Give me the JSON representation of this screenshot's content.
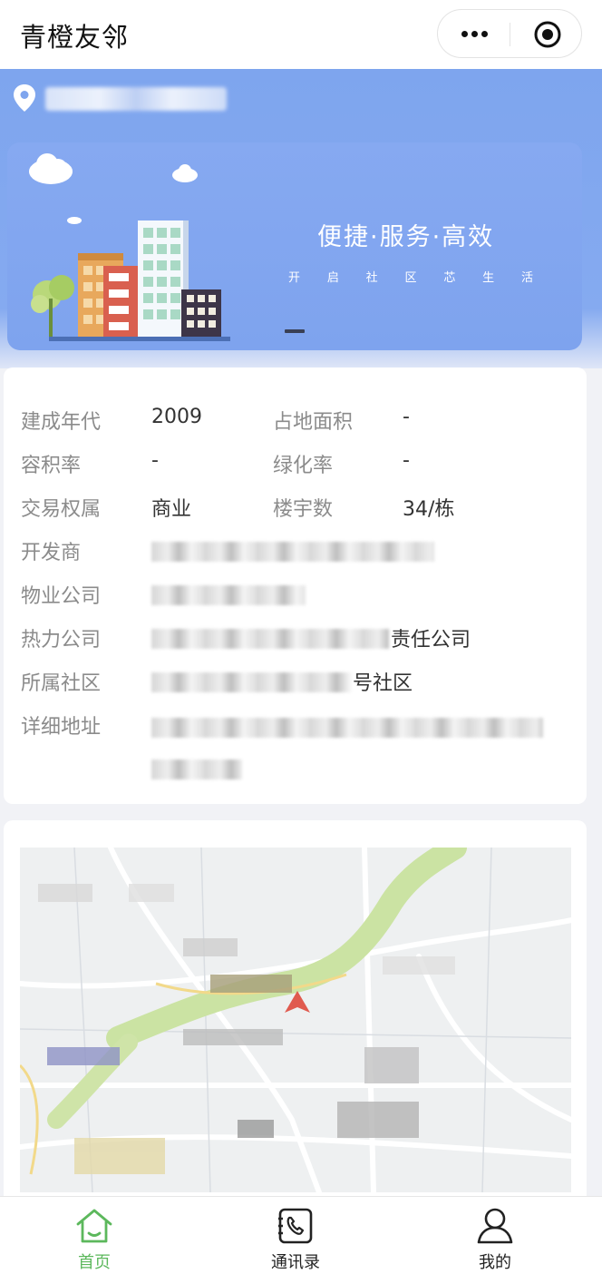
{
  "app": {
    "title": "青橙友邻"
  },
  "capsule": {
    "more_icon": "more-dots-icon",
    "close_icon": "target-icon"
  },
  "location": {
    "icon": "location-pin-icon"
  },
  "banner": {
    "slogan": "便捷·服务·高效",
    "sub_slogan": [
      "开",
      "启",
      "社",
      "区",
      "芯",
      "生",
      "活"
    ]
  },
  "info": {
    "rows": [
      {
        "label": "建成年代",
        "value": "2009",
        "label2": "占地面积",
        "value2": "-"
      },
      {
        "label": "容积率",
        "value": "-",
        "label2": "绿化率",
        "value2": "-"
      },
      {
        "label": "交易权属",
        "value": "商业",
        "label2": "楼宇数",
        "value2": "34/栋"
      },
      {
        "label": "开发商"
      },
      {
        "label": "物业公司"
      },
      {
        "label": "热力公司",
        "value_visible": "责任公司"
      },
      {
        "label": "所属社区",
        "value_visible": "号社区"
      },
      {
        "label": "详细地址"
      }
    ]
  },
  "tabs": [
    {
      "label": "首页",
      "icon": "home-icon",
      "active": true
    },
    {
      "label": "通讯录",
      "icon": "contacts-phone-icon",
      "active": false
    },
    {
      "label": "我的",
      "icon": "user-icon",
      "active": false
    }
  ],
  "colors": {
    "header_blue": "#7ea5ee",
    "accent_green": "#5cb85c",
    "map_marker": "#e05a4f"
  }
}
